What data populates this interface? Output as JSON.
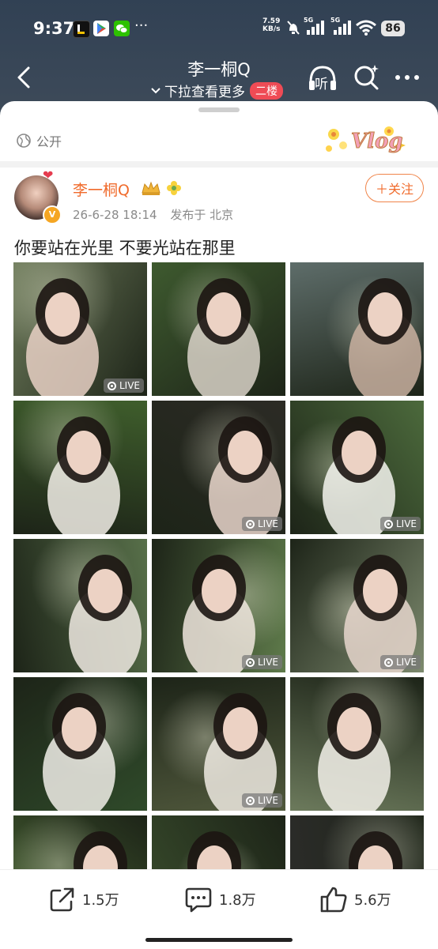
{
  "status_bar": {
    "time": "9:37",
    "more": "···",
    "net_speed_value": "7.59",
    "net_speed_unit": "KB/s",
    "signal_1": "5G",
    "signal_2": "5G",
    "battery": "86"
  },
  "nav": {
    "title": "李一桐Q",
    "subtitle": "下拉查看更多",
    "floor_badge": "二楼",
    "listen_label": "听"
  },
  "post": {
    "visibility": "公开",
    "sticker_text": "Vlog",
    "author": "李一桐Q",
    "timestamp": "26-6-28 18:14",
    "location": "发布于 北京",
    "follow_label": "＋关注",
    "text": "你要站在光里 不要光站在那里",
    "live_label": "LIVE",
    "photos": [
      {
        "live": true,
        "bg": "#6d7a5a",
        "accent": "#e8d0c4"
      },
      {
        "live": false,
        "bg": "#3e5a2f",
        "accent": "#d9d2c8"
      },
      {
        "live": false,
        "bg": "#5e6d6a",
        "accent": "#c9b0a0"
      },
      {
        "live": false,
        "bg": "#3f5e2c",
        "accent": "#f2eee8"
      },
      {
        "live": true,
        "bg": "#2c2b25",
        "accent": "#e9d6cb"
      },
      {
        "live": true,
        "bg": "#4c6a3c",
        "accent": "#f4f4ee"
      },
      {
        "live": false,
        "bg": "#58704a",
        "accent": "#efe9e2"
      },
      {
        "live": true,
        "bg": "#5f7b4b",
        "accent": "#f0e6de"
      },
      {
        "live": true,
        "bg": "#7d8a6e",
        "accent": "#e6d6cc"
      },
      {
        "live": false,
        "bg": "#2f4a2a",
        "accent": "#f1efe9"
      },
      {
        "live": true,
        "bg": "#50583c",
        "accent": "#eeeae2"
      },
      {
        "live": false,
        "bg": "#6c7a5c",
        "accent": "#f3f1ea"
      },
      {
        "live": false,
        "bg": "#4d6b36",
        "accent": "#dcd4c8"
      },
      {
        "live": false,
        "bg": "#3a4e2d",
        "accent": "#d8cfc6"
      },
      {
        "live": false,
        "bg": "#2c2c2a",
        "accent": "#cbb8ad"
      }
    ]
  },
  "actions": {
    "share_count": "1.5万",
    "comment_count": "1.8万",
    "like_count": "5.6万"
  },
  "colors": {
    "accent_orange": "#f06b2c",
    "badge_red": "#ef4b55",
    "header_bg": "#344457"
  }
}
